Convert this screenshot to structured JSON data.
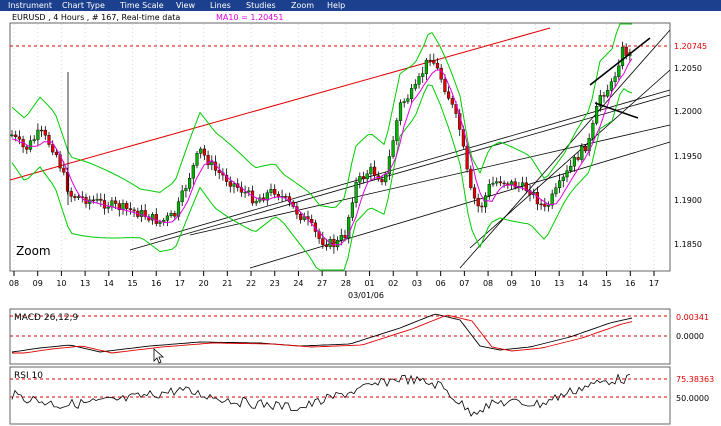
{
  "menu": {
    "items": [
      "Instrument",
      "Chart Type",
      "Time Scale",
      "View",
      "Lines",
      "Studies",
      "Zoom",
      "Help"
    ]
  },
  "header": {
    "info": "EURUSD , 4 Hours , # 167, Real-time data",
    "study": "MA10 = 1.20451"
  },
  "price_chart": {
    "y_ticks": [
      "1.2050",
      "1.2000",
      "1.1950",
      "1.1900",
      "1.1850"
    ],
    "price_label": "1.20745",
    "zoom_label": "Zoom",
    "x_ticks": [
      "08",
      "09",
      "10",
      "13",
      "14",
      "15",
      "16",
      "17",
      "20",
      "21",
      "22",
      "23",
      "24",
      "27",
      "28",
      "01",
      "02",
      "03",
      "06",
      "07",
      "08",
      "09",
      "10",
      "13",
      "14",
      "15",
      "16",
      "17"
    ],
    "x_date": "03/01/06"
  },
  "macd_panel": {
    "title": "MACD 26,12,9",
    "value_label": "0.00341",
    "zero_label": "0.0000"
  },
  "rsi_panel": {
    "title": "RSI 10",
    "value_label": "75.38363",
    "mid_label": "50.0000"
  },
  "colors": {
    "menubar": "#1c3f8e",
    "up_candle": "#00b000",
    "down_candle": "#e00000",
    "bollinger": "#00cc00",
    "moving_average": "#e000e0",
    "channel_red": "#e00000",
    "level_dashed": "#e00000"
  }
}
